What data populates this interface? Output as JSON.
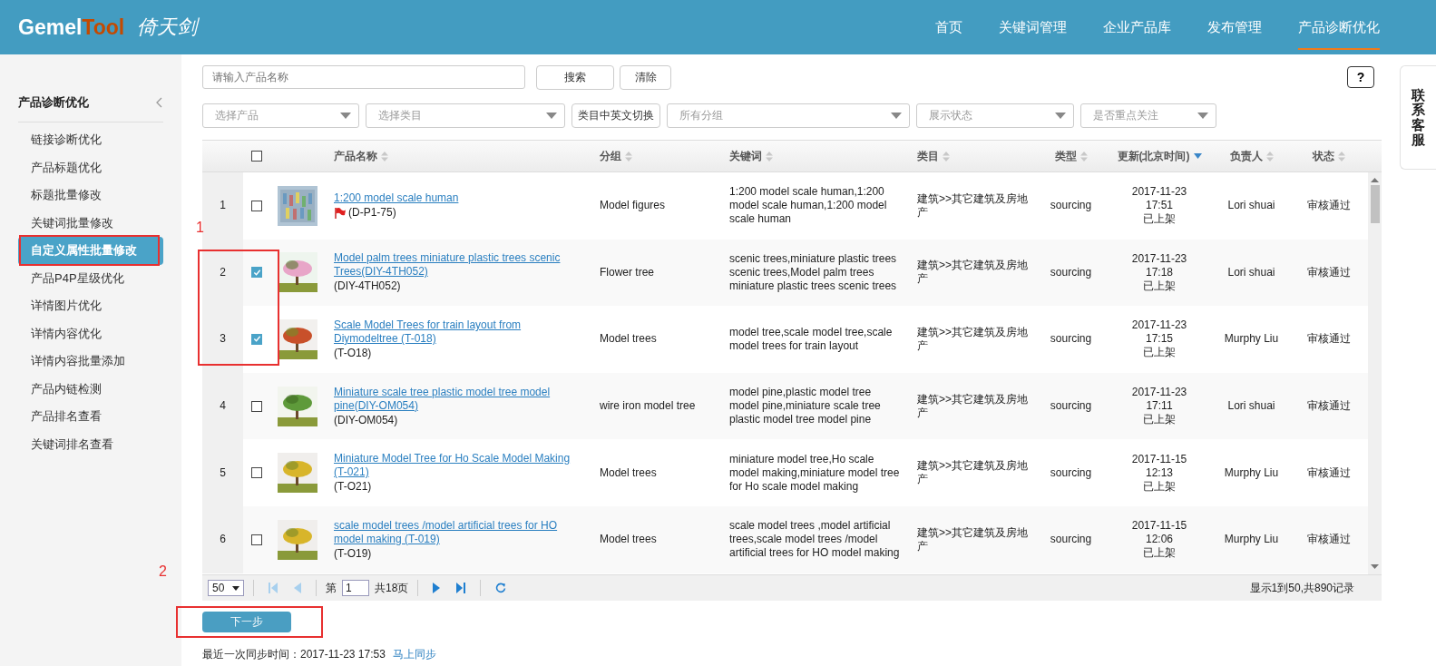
{
  "header": {
    "logo_main": "Gemel",
    "logo_accent": "Tool",
    "logo_cn": "倚天剑",
    "nav": [
      {
        "label": "首页",
        "selected": false
      },
      {
        "label": "关键词管理",
        "selected": false
      },
      {
        "label": "企业产品库",
        "selected": false
      },
      {
        "label": "发布管理",
        "selected": false
      },
      {
        "label": "产品诊断优化",
        "selected": true
      }
    ]
  },
  "sidebar": {
    "title": "产品诊断优化",
    "items": [
      {
        "label": "链接诊断优化",
        "selected": false
      },
      {
        "label": "产品标题优化",
        "selected": false
      },
      {
        "label": "标题批量修改",
        "selected": false
      },
      {
        "label": "关键词批量修改",
        "selected": false
      },
      {
        "label": "自定义属性批量修改",
        "selected": true
      },
      {
        "label": "产品P4P星级优化",
        "selected": false
      },
      {
        "label": "详情图片优化",
        "selected": false
      },
      {
        "label": "详情内容优化",
        "selected": false
      },
      {
        "label": "详情内容批量添加",
        "selected": false
      },
      {
        "label": "产品内链检测",
        "selected": false
      },
      {
        "label": "产品排名查看",
        "selected": false
      },
      {
        "label": "关键词排名查看",
        "selected": false
      }
    ]
  },
  "search": {
    "placeholder": "请输入产品名称",
    "search_button": "搜索",
    "clear_button": "清除"
  },
  "filters": [
    {
      "kind": "select",
      "placeholder": "选择产品"
    },
    {
      "kind": "select",
      "placeholder": "选择类目"
    },
    {
      "kind": "button",
      "label": "类目中英文切换"
    },
    {
      "kind": "select",
      "placeholder": "所有分组"
    },
    {
      "kind": "select",
      "placeholder": "展示状态"
    },
    {
      "kind": "select",
      "placeholder": "是否重点关注"
    }
  ],
  "help_button": "?",
  "contact_tab": "联系客服",
  "table": {
    "select_all_checked": false,
    "columns": [
      {
        "label": "产品名称",
        "sorted": false
      },
      {
        "label": "分组",
        "sorted": false
      },
      {
        "label": "关键词",
        "sorted": false
      },
      {
        "label": "类目",
        "sorted": false
      },
      {
        "label": "类型",
        "sorted": false
      },
      {
        "label": "更新(北京时间)",
        "sorted": true
      },
      {
        "label": "负责人",
        "sorted": false
      },
      {
        "label": "状态",
        "sorted": false
      }
    ],
    "rows": [
      {
        "index": "1",
        "checked": false,
        "flagged": true,
        "name": "1:200 model scale human",
        "code": "(D-P1-75)",
        "group": "Model figures",
        "keywords": "1:200 model scale human,1:200 model scale human,1:200 model scale human",
        "category": "建筑>>其它建筑及房地产",
        "type": "sourcing",
        "date": "2017-11-23",
        "time": "17:51",
        "shelf": "已上架",
        "owner": "Lori shuai",
        "status": "审核通过"
      },
      {
        "index": "2",
        "checked": true,
        "flagged": false,
        "name": "Model palm trees miniature plastic trees scenic Trees(DIY-4TH052)",
        "code": "(DIY-4TH052)",
        "group": "Flower tree",
        "keywords": "scenic trees,miniature plastic trees scenic trees,Model palm trees miniature plastic trees scenic trees",
        "category": "建筑>>其它建筑及房地产",
        "type": "sourcing",
        "date": "2017-11-23",
        "time": "17:18",
        "shelf": "已上架",
        "owner": "Lori shuai",
        "status": "审核通过"
      },
      {
        "index": "3",
        "checked": true,
        "flagged": false,
        "name": "Scale Model Trees for train layout from Diymodeltree (T-018)",
        "code": "(T-O18)",
        "group": "Model trees",
        "keywords": "model tree,scale model tree,scale model trees for train layout",
        "category": "建筑>>其它建筑及房地产",
        "type": "sourcing",
        "date": "2017-11-23",
        "time": "17:15",
        "shelf": "已上架",
        "owner": "Murphy Liu",
        "status": "审核通过"
      },
      {
        "index": "4",
        "checked": false,
        "flagged": false,
        "name": "Miniature scale tree plastic model tree model pine(DIY-OM054)",
        "code": "(DIY-OM054)",
        "group": "wire iron model tree",
        "keywords": "model pine,plastic model tree model pine,miniature scale tree plastic model tree model pine",
        "category": "建筑>>其它建筑及房地产",
        "type": "sourcing",
        "date": "2017-11-23",
        "time": "17:11",
        "shelf": "已上架",
        "owner": "Lori shuai",
        "status": "审核通过"
      },
      {
        "index": "5",
        "checked": false,
        "flagged": false,
        "name": "Miniature Model Tree for Ho Scale Model Making (T-021)",
        "code": "(T-O21)",
        "group": "Model trees",
        "keywords": "miniature model tree,Ho scale model making,miniature model tree for Ho scale model making",
        "category": "建筑>>其它建筑及房地产",
        "type": "sourcing",
        "date": "2017-11-15",
        "time": "12:13",
        "shelf": "已上架",
        "owner": "Murphy Liu",
        "status": "审核通过"
      },
      {
        "index": "6",
        "checked": false,
        "flagged": false,
        "name": "scale model trees /model artificial trees for HO model making (T-019)",
        "code": "(T-O19)",
        "group": "Model trees",
        "keywords": "scale model trees ,model artificial trees,scale model trees /model artificial trees for HO model making",
        "category": "建筑>>其它建筑及房地产",
        "type": "sourcing",
        "date": "2017-11-15",
        "time": "12:06",
        "shelf": "已上架",
        "owner": "Murphy Liu",
        "status": "审核通过"
      }
    ]
  },
  "pager": {
    "page_size": "50",
    "page_prefix": "第",
    "page": "1",
    "page_total": "共18页",
    "summary": "显示1到50,共890记录"
  },
  "next_button": "下一步",
  "sync": {
    "label": "最近一次同步时间：2017-11-23 17:53",
    "link": "马上同步"
  },
  "annotations": [
    "1",
    "2"
  ]
}
